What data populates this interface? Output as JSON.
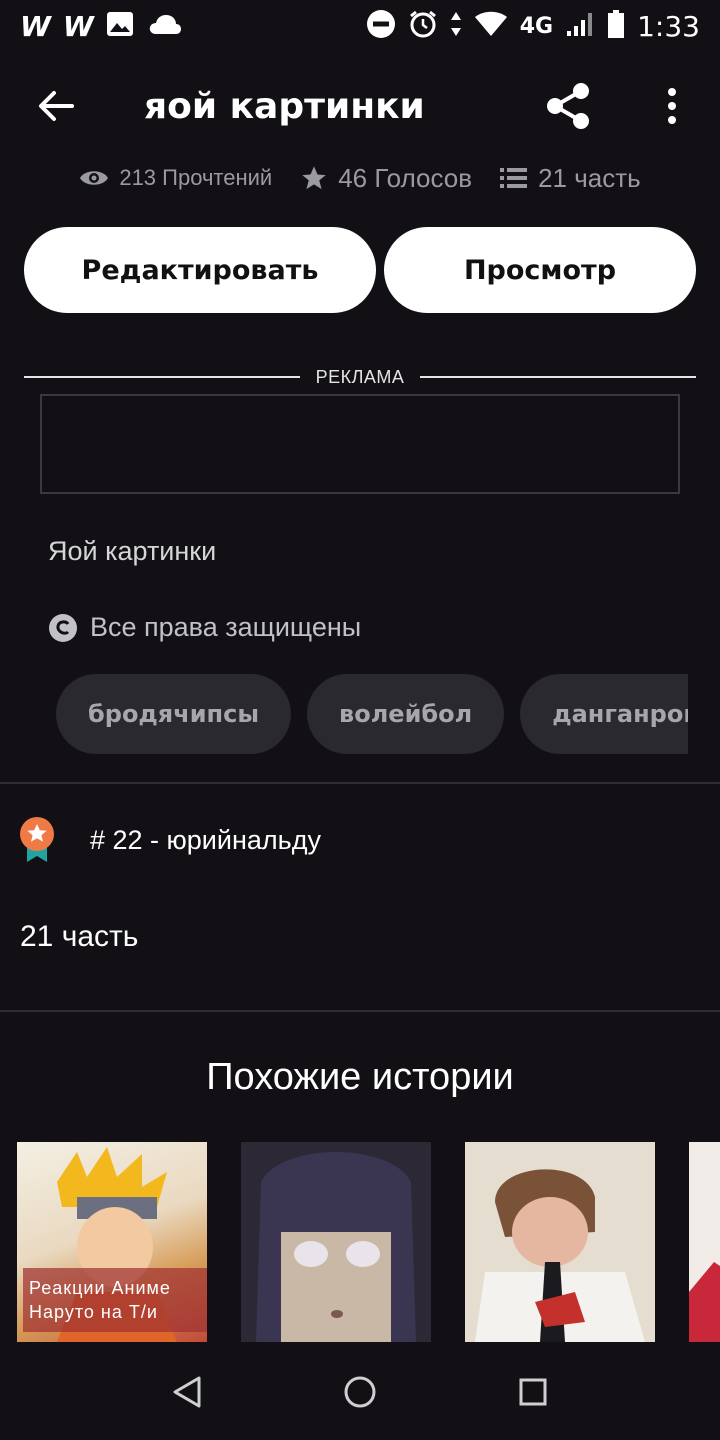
{
  "status_bar": {
    "left_icons": [
      "wattpad-w-icon",
      "wattpad-w-icon",
      "image-icon",
      "cloud-icon"
    ],
    "network": "4G",
    "time": "1:33"
  },
  "app_bar": {
    "title": "яой картинки"
  },
  "stats": {
    "reads": "213 Прочтений",
    "votes": "46 Голосов",
    "parts": "21 часть"
  },
  "buttons": {
    "edit": "Редактировать",
    "view": "Просмотр"
  },
  "ad": {
    "label": "РЕКЛАМА"
  },
  "description": "Яой картинки",
  "copyright": "Все права защищены",
  "tags": [
    "бродячипсы",
    "волейбол",
    "данганромпа"
  ],
  "ranking": {
    "text": "# 22 - юрийнальду"
  },
  "parts_count": "21 часть",
  "similar": {
    "title": "Похожие истории",
    "cover1_caption_line1": "Реакции Аниме",
    "cover1_caption_line2": "Наруто на Т/и"
  },
  "colors": {
    "background": "#121014",
    "tag_bg": "#2a292d",
    "rank_badge": "#f07a45",
    "rank_ribbon": "#1fa3a3"
  }
}
